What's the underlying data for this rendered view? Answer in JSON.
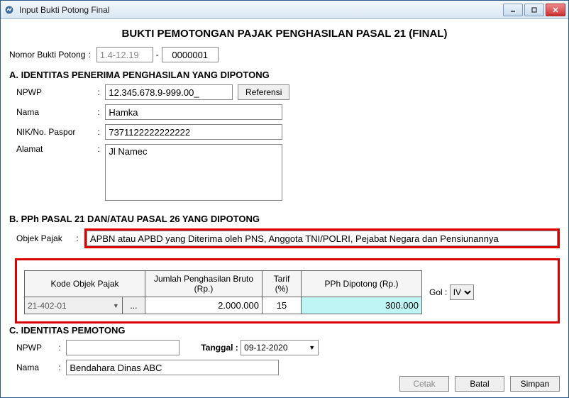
{
  "window": {
    "title": "Input Bukti Potong Final"
  },
  "header": {
    "main_title": "BUKTI PEMOTONGAN PAJAK PENGHASILAN PASAL 21 (FINAL)",
    "nomor_label": "Nomor Bukti Potong",
    "nomor_prefix": "1.4-12.19",
    "nomor_value": "0000001"
  },
  "section_a": {
    "title": "A. IDENTITAS PENERIMA PENGHASILAN YANG DIPOTONG",
    "npwp_label": "NPWP",
    "npwp_value": "12.345.678.9-999.00_",
    "ref_btn": "Referensi",
    "nama_label": "Nama",
    "nama_value": "Hamka",
    "nik_label": "NIK/No. Paspor",
    "nik_value": "7371122222222222",
    "alamat_label": "Alamat",
    "alamat_value": "Jl Namec"
  },
  "section_b": {
    "title": "B. PPh PASAL 21 DAN/ATAU PASAL 26 YANG DIPOTONG",
    "objek_label": "Objek Pajak",
    "objek_value": "APBN atau APBD yang Diterima oleh PNS, Anggota TNI/POLRI, Pejabat Negara dan Pensiunannya",
    "table": {
      "headers": {
        "kode": "Kode Objek Pajak",
        "bruto": "Jumlah Penghasilan Bruto (Rp.)",
        "tarif": "Tarif (%)",
        "dipotong": "PPh Dipotong (Rp.)"
      },
      "row": {
        "kode": "21-402-01",
        "ellipsis": "...",
        "bruto": "2.000.000",
        "tarif": "15",
        "dipotong": "300.000"
      },
      "gol_label": "Gol :",
      "gol_value": "IV"
    }
  },
  "section_c": {
    "title": "C. IDENTITAS PEMOTONG",
    "npwp_label": "NPWP",
    "npwp_value": "",
    "tanggal_label": "Tanggal :",
    "tanggal_value": "09-12-2020",
    "nama_label": "Nama",
    "nama_value": "Bendahara Dinas ABC"
  },
  "buttons": {
    "cetak": "Cetak",
    "batal": "Batal",
    "simpan": "Simpan"
  }
}
